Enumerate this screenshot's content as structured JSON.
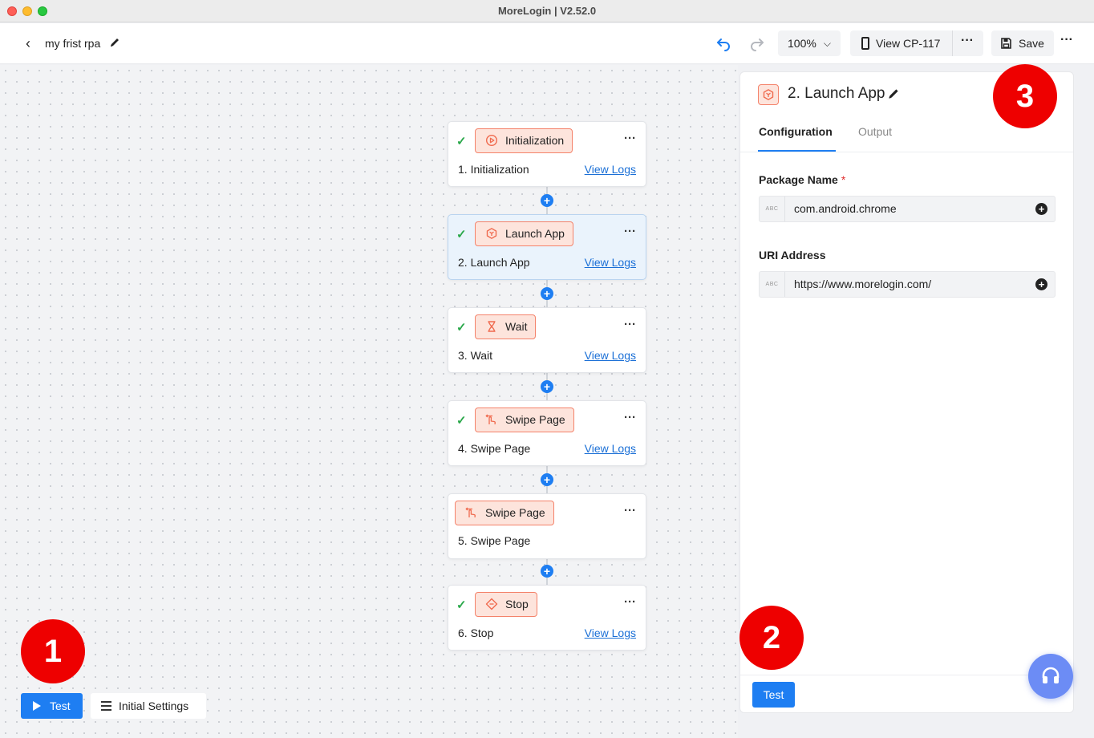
{
  "window": {
    "title": "MoreLogin | V2.52.0"
  },
  "toolbar": {
    "flow_name": "my frist rpa",
    "zoom": "100%",
    "view_cp": "View CP-117",
    "save_label": "Save"
  },
  "nodes": [
    {
      "chip": "Initialization",
      "title": "1. Initialization",
      "logs": "View Logs",
      "checked": true
    },
    {
      "chip": "Launch App",
      "title": "2. Launch App",
      "logs": "View Logs",
      "checked": true
    },
    {
      "chip": "Wait",
      "title": "3. Wait",
      "logs": "View Logs",
      "checked": true
    },
    {
      "chip": "Swipe Page",
      "title": "4. Swipe Page",
      "logs": "View Logs",
      "checked": true
    },
    {
      "chip": "Swipe Page",
      "title": "5. Swipe Page",
      "logs": "",
      "checked": false
    },
    {
      "chip": "Stop",
      "title": "6. Stop",
      "logs": "View Logs",
      "checked": true
    }
  ],
  "bottom": {
    "test_label": "Test",
    "initial_settings_label": "Initial Settings"
  },
  "panel": {
    "title": "2. Launch App",
    "tabs": [
      "Configuration",
      "Output"
    ],
    "fields": [
      {
        "label": "Package Name",
        "required_mark": "*",
        "value": "com.android.chrome",
        "type_tag": "ABC"
      },
      {
        "label": "URI Address",
        "value": "https://www.morelogin.com/",
        "type_tag": "ABC"
      }
    ],
    "test_label": "Test"
  },
  "badges": [
    "1",
    "2",
    "3"
  ],
  "colors": {
    "accent": "#1e7ef2",
    "chip_border": "#f4826a",
    "chip_bg": "#fde4dc",
    "badge": "#ee0000"
  }
}
